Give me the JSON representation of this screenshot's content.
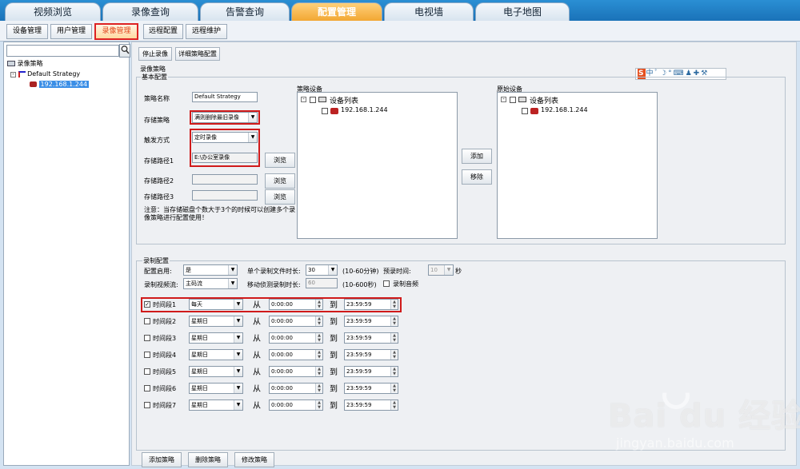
{
  "tabs": [
    "视频浏览",
    "录像查询",
    "告警查询",
    "配置管理",
    "电视墙",
    "电子地图"
  ],
  "subnav": [
    "设备管理",
    "用户管理",
    "录像管理",
    "远程配置",
    "远程维护"
  ],
  "tree": {
    "root": "录像策略",
    "strategy": "Default Strategy",
    "device": "192.168.1.244"
  },
  "toolbar": {
    "stop": "停止录像",
    "detail": "详细策略配置"
  },
  "section_title": "录像策略",
  "basic": {
    "title": "基本配置",
    "name_label": "策略名称",
    "name_value": "Default Strategy",
    "storage_label": "存储策略",
    "storage_value": "满则删除最旧录像",
    "trigger_label": "触发方式",
    "trigger_value": "定时录像",
    "path1_label": "存储路径1",
    "path1_value": "E:\\办公室录像",
    "path2_label": "存储路径2",
    "path3_label": "存储路径3",
    "browse": "浏览",
    "note": "注意：当存储磁盘个数大于3个的时候可以创建多个录像策略进行配置使用！"
  },
  "strategy_devices": {
    "title": "策略设备",
    "list": "设备列表",
    "device": "192.168.1.244"
  },
  "source_devices": {
    "title": "原始设备",
    "list": "设备列表",
    "device": "192.168.1.244"
  },
  "add": "添加",
  "remove": "移除",
  "ime": [
    "S",
    "中",
    "ﾟ",
    "☽",
    "°",
    "⌨",
    "♟",
    "✚",
    "⚒"
  ],
  "record": {
    "title": "录制配置",
    "enable_label": "配置启用:",
    "enable_value": "是",
    "duration_label": "单个录制文件时长:",
    "duration_value": "30",
    "duration_range": "(10-60分钟)",
    "prerecord_label": "预录时间:",
    "prerecord_value": "10",
    "prerecord_unit": "秒",
    "stream_label": "录制视频流:",
    "stream_value": "主码流",
    "motion_label": "移动侦测录制时长:",
    "motion_value": "60",
    "motion_range": "(10-600秒)",
    "audio_label": "录制音频"
  },
  "from": "从",
  "to": "到",
  "segments": [
    {
      "label": "时间段1",
      "day": "每天",
      "start": "0:00:00",
      "end": "23:59:59",
      "checked": true
    },
    {
      "label": "时间段2",
      "day": "星期日",
      "start": "0:00:00",
      "end": "23:59:59",
      "checked": false
    },
    {
      "label": "时间段3",
      "day": "星期日",
      "start": "0:00:00",
      "end": "23:59:59",
      "checked": false
    },
    {
      "label": "时间段4",
      "day": "星期日",
      "start": "0:00:00",
      "end": "23:59:59",
      "checked": false
    },
    {
      "label": "时间段5",
      "day": "星期日",
      "start": "0:00:00",
      "end": "23:59:59",
      "checked": false
    },
    {
      "label": "时间段6",
      "day": "星期日",
      "start": "0:00:00",
      "end": "23:59:59",
      "checked": false
    },
    {
      "label": "时间段7",
      "day": "星期日",
      "start": "0:00:00",
      "end": "23:59:59",
      "checked": false
    }
  ],
  "bottom": {
    "add": "添加策略",
    "delete": "删除策略",
    "modify": "修改策略"
  },
  "watermark": {
    "logo": "Bai du 经验",
    "url": "jingyan.baidu.com"
  }
}
